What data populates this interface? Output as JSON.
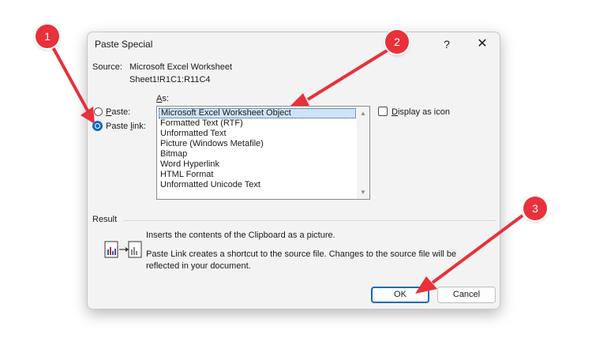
{
  "dialog": {
    "title": "Paste Special",
    "help_label": "?",
    "close_label": "✕",
    "source_label": "Source:",
    "source_value": "Microsoft Excel Worksheet",
    "source_range": "Sheet1!R1C1:R11C4",
    "as_label_prefix": "A",
    "as_label_suffix": "s:",
    "paste_option_prefix": "P",
    "paste_option_suffix": "aste:",
    "paste_link_prefix": "Paste ",
    "paste_link_underline": "l",
    "paste_link_suffix": "ink:",
    "selected_option": "Paste link",
    "list_items": [
      "Microsoft Excel Worksheet Object",
      "Formatted Text (RTF)",
      "Unformatted Text",
      "Picture (Windows Metafile)",
      "Bitmap",
      "Word Hyperlink",
      "HTML Format",
      "Unformatted Unicode Text"
    ],
    "selected_item": "Microsoft Excel Worksheet Object",
    "display_as_icon_prefix": "D",
    "display_as_icon_suffix": "isplay as icon",
    "display_as_icon_checked": false,
    "result_label": "Result",
    "result_line1": "Inserts the contents of the Clipboard as a picture.",
    "result_line2": "Paste Link creates a shortcut to the source file. Changes to the source file will be",
    "result_line3": "reflected in your document.",
    "ok_label": "OK",
    "cancel_label": "Cancel"
  },
  "annotations": {
    "badge1": "1",
    "badge2": "2",
    "badge3": "3",
    "color": "#e8313a"
  },
  "colors": {
    "accent": "#0f6cbd",
    "selection": "#cfe3f7"
  }
}
